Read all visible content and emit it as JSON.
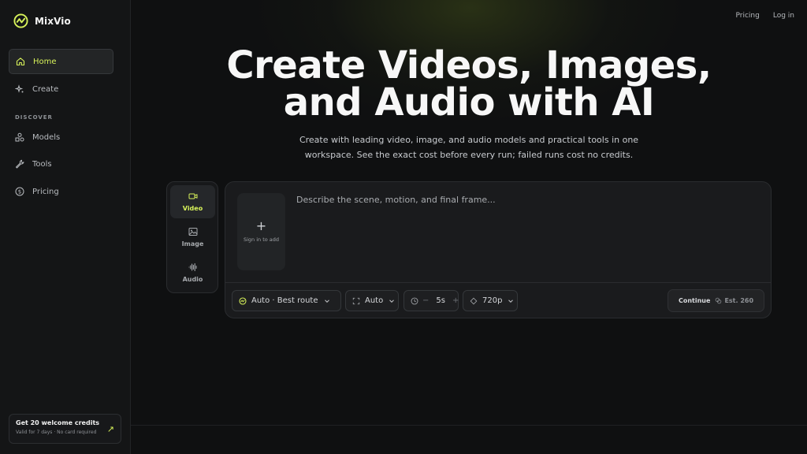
{
  "brand": {
    "name": "MixVio",
    "icon": "mixvio-logo-icon",
    "accent": "#d7f25a"
  },
  "sidebar": {
    "items": [
      {
        "label": "Home",
        "icon": "home-icon",
        "active": true
      },
      {
        "label": "Create",
        "icon": "sparkle-icon"
      }
    ],
    "section_label": "DISCOVER",
    "discover_items": [
      {
        "label": "Models",
        "icon": "shapes-icon"
      },
      {
        "label": "Tools",
        "icon": "wrench-icon"
      },
      {
        "label": "Pricing",
        "icon": "dollar-icon"
      }
    ],
    "credits": {
      "title": "Get 20 welcome credits",
      "subtitle": "Valid for 7 days · No card required",
      "arrow": "↗"
    }
  },
  "topnav": {
    "pricing": "Pricing",
    "login": "Log in"
  },
  "hero": {
    "title_line1": "Create Videos, Images,",
    "title_line2": "and Audio with AI",
    "subtitle": "Create with leading video, image, and audio models and practical tools in one workspace. See the exact cost before every run; failed runs cost no credits."
  },
  "modes": [
    {
      "label": "Video",
      "icon": "video-icon",
      "active": true
    },
    {
      "label": "Image",
      "icon": "image-icon"
    },
    {
      "label": "Audio",
      "icon": "waveform-icon"
    }
  ],
  "composer": {
    "add_plus": "+",
    "add_label": "Sign in to add",
    "prompt_placeholder": "Describe the scene, motion, and final frame...",
    "model": {
      "value": "Auto · Best route"
    },
    "aspect": {
      "value": "Auto"
    },
    "duration": {
      "minus": "−",
      "value": "5s",
      "plus": "+"
    },
    "resolution": {
      "value": "720p"
    },
    "continue_label": "Continue",
    "estimate": "Est. 260"
  }
}
